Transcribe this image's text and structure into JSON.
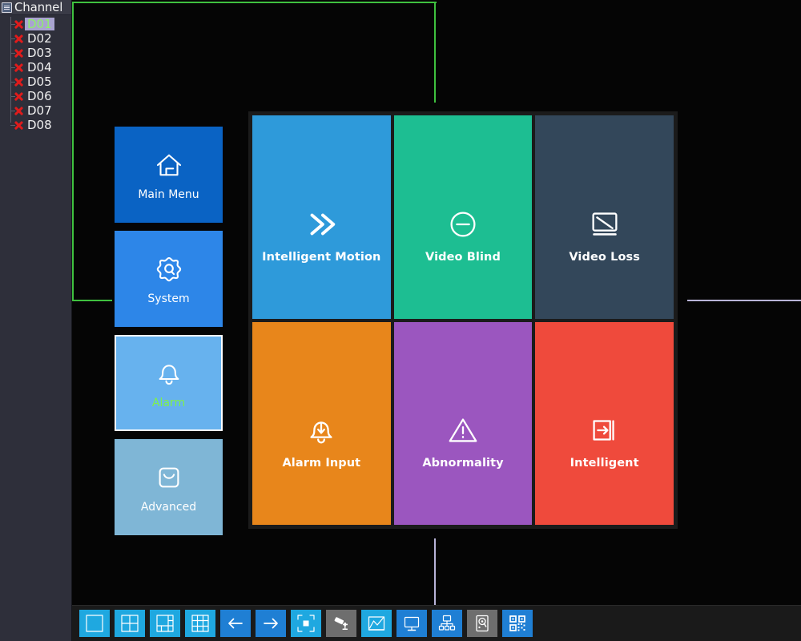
{
  "app": {
    "background_color": "#000000",
    "overlay_line_color": "#3fc13f",
    "overlay_line_color_secondary": "#b9b4d8"
  },
  "channel_panel": {
    "title": "Channel",
    "header_icon": "list-document-icon",
    "items": [
      {
        "label": "D01",
        "status_icon": "red-x-icon",
        "selected": true
      },
      {
        "label": "D02",
        "status_icon": "red-x-icon",
        "selected": false
      },
      {
        "label": "D03",
        "status_icon": "red-x-icon",
        "selected": false
      },
      {
        "label": "D04",
        "status_icon": "red-x-icon",
        "selected": false
      },
      {
        "label": "D05",
        "status_icon": "red-x-icon",
        "selected": false
      },
      {
        "label": "D06",
        "status_icon": "red-x-icon",
        "selected": false
      },
      {
        "label": "D07",
        "status_icon": "red-x-icon",
        "selected": false
      },
      {
        "label": "D08",
        "status_icon": "red-x-icon",
        "selected": false
      }
    ]
  },
  "menu_column": {
    "items": [
      {
        "label": "Main Menu",
        "icon": "home-icon",
        "color": "#0a63c4",
        "selected": false
      },
      {
        "label": "System",
        "icon": "gear-icon",
        "color": "#2d86e8",
        "selected": false
      },
      {
        "label": "Alarm",
        "icon": "bell-icon",
        "color": "#67b2ee",
        "selected": true
      },
      {
        "label": "Advanced",
        "icon": "box-smile-icon",
        "color": "#7fb6d6",
        "selected": false
      }
    ],
    "selected_label_color": "#7ff04a"
  },
  "tile_grid": {
    "tiles": [
      {
        "label": "Intelligent Motion",
        "icon": "double-chevron-right-icon",
        "color": "#2e9ada"
      },
      {
        "label": "Video Blind",
        "icon": "minus-circle-icon",
        "color": "#1dbe92"
      },
      {
        "label": "Video Loss",
        "icon": "monitor-slash-icon",
        "color": "#33475a"
      },
      {
        "label": "Alarm Input",
        "icon": "bell-arrow-down-icon",
        "color": "#e8861b"
      },
      {
        "label": "Abnormality",
        "icon": "warning-triangle-icon",
        "color": "#9b56bf"
      },
      {
        "label": "Intelligent",
        "icon": "arrow-into-panel-icon",
        "color": "#ef4a3c"
      }
    ]
  },
  "toolbar": {
    "buttons": [
      {
        "name": "layout-1-button",
        "icon": "single-pane-icon",
        "style": "cyan",
        "enabled": true
      },
      {
        "name": "layout-4-button",
        "icon": "quad-pane-icon",
        "style": "cyan",
        "enabled": true
      },
      {
        "name": "layout-6-button",
        "icon": "six-pane-icon",
        "style": "cyan",
        "enabled": true
      },
      {
        "name": "layout-9-button",
        "icon": "nine-pane-icon",
        "style": "cyan",
        "enabled": true
      },
      {
        "name": "previous-page-button",
        "icon": "arrow-left-icon",
        "style": "blue",
        "enabled": true
      },
      {
        "name": "next-page-button",
        "icon": "arrow-right-icon",
        "style": "blue",
        "enabled": true
      },
      {
        "name": "zoom-region-button",
        "icon": "focus-frame-icon",
        "style": "cyan",
        "enabled": true
      },
      {
        "name": "ptz-camera-button",
        "icon": "camera-icon",
        "style": "gray",
        "enabled": false
      },
      {
        "name": "image-color-button",
        "icon": "picture-chart-icon",
        "style": "cyan",
        "enabled": true
      },
      {
        "name": "display-button",
        "icon": "monitor-icon",
        "style": "blue",
        "enabled": true
      },
      {
        "name": "network-button",
        "icon": "network-tree-icon",
        "style": "blue",
        "enabled": true
      },
      {
        "name": "hdd-manage-button",
        "icon": "hard-disk-icon",
        "style": "gray",
        "enabled": false
      },
      {
        "name": "qr-code-button",
        "icon": "qr-code-icon",
        "style": "blue",
        "enabled": true
      }
    ]
  }
}
